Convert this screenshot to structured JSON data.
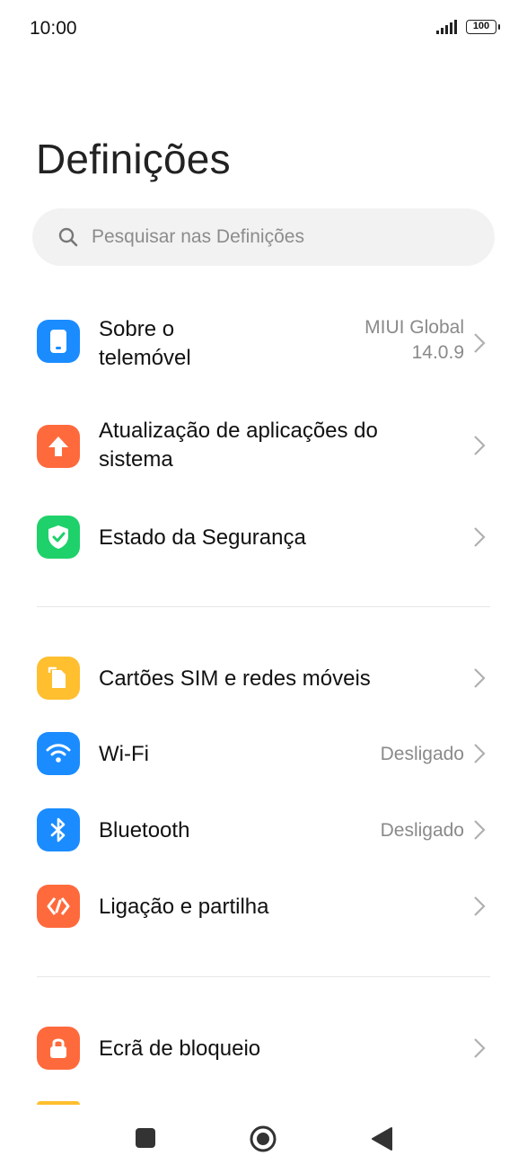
{
  "status_bar": {
    "time": "10:00",
    "battery": "100",
    "signal_icon": "signal-bars-icon"
  },
  "page": {
    "title": "Definições"
  },
  "search": {
    "placeholder": "Pesquisar nas Definições",
    "icon": "search-icon"
  },
  "items": [
    {
      "label_line1": "Sobre o",
      "label_line2": "telemóvel",
      "value_line1": "MIUI Global",
      "value_line2": "14.0.9",
      "icon": "phone-icon",
      "color": "#1a8cff"
    },
    {
      "label_line1": "Atualização de aplicações do",
      "label_line2": "sistema",
      "icon": "arrow-up-icon",
      "color": "#ff6a3d"
    },
    {
      "label": "Estado da Segurança",
      "icon": "shield-check-icon",
      "color": "#1fd16a"
    },
    {
      "label": "Cartões SIM e redes móveis",
      "icon": "sim-card-icon",
      "color": "#ffbf2f"
    },
    {
      "label": "Wi-Fi",
      "value": "Desligado",
      "icon": "wifi-icon",
      "color": "#1a8cff"
    },
    {
      "label": "Bluetooth",
      "value": "Desligado",
      "icon": "bluetooth-icon",
      "color": "#1a8cff"
    },
    {
      "label": "Ligação e partilha",
      "icon": "connection-sharing-icon",
      "color": "#ff6a3d"
    },
    {
      "label": "Ecrã de bloqueio",
      "icon": "lock-icon",
      "color": "#ff6a3d"
    }
  ],
  "nav": {
    "recents_icon": "square-icon",
    "home_icon": "circle-icon",
    "back_icon": "back-triangle-icon"
  }
}
